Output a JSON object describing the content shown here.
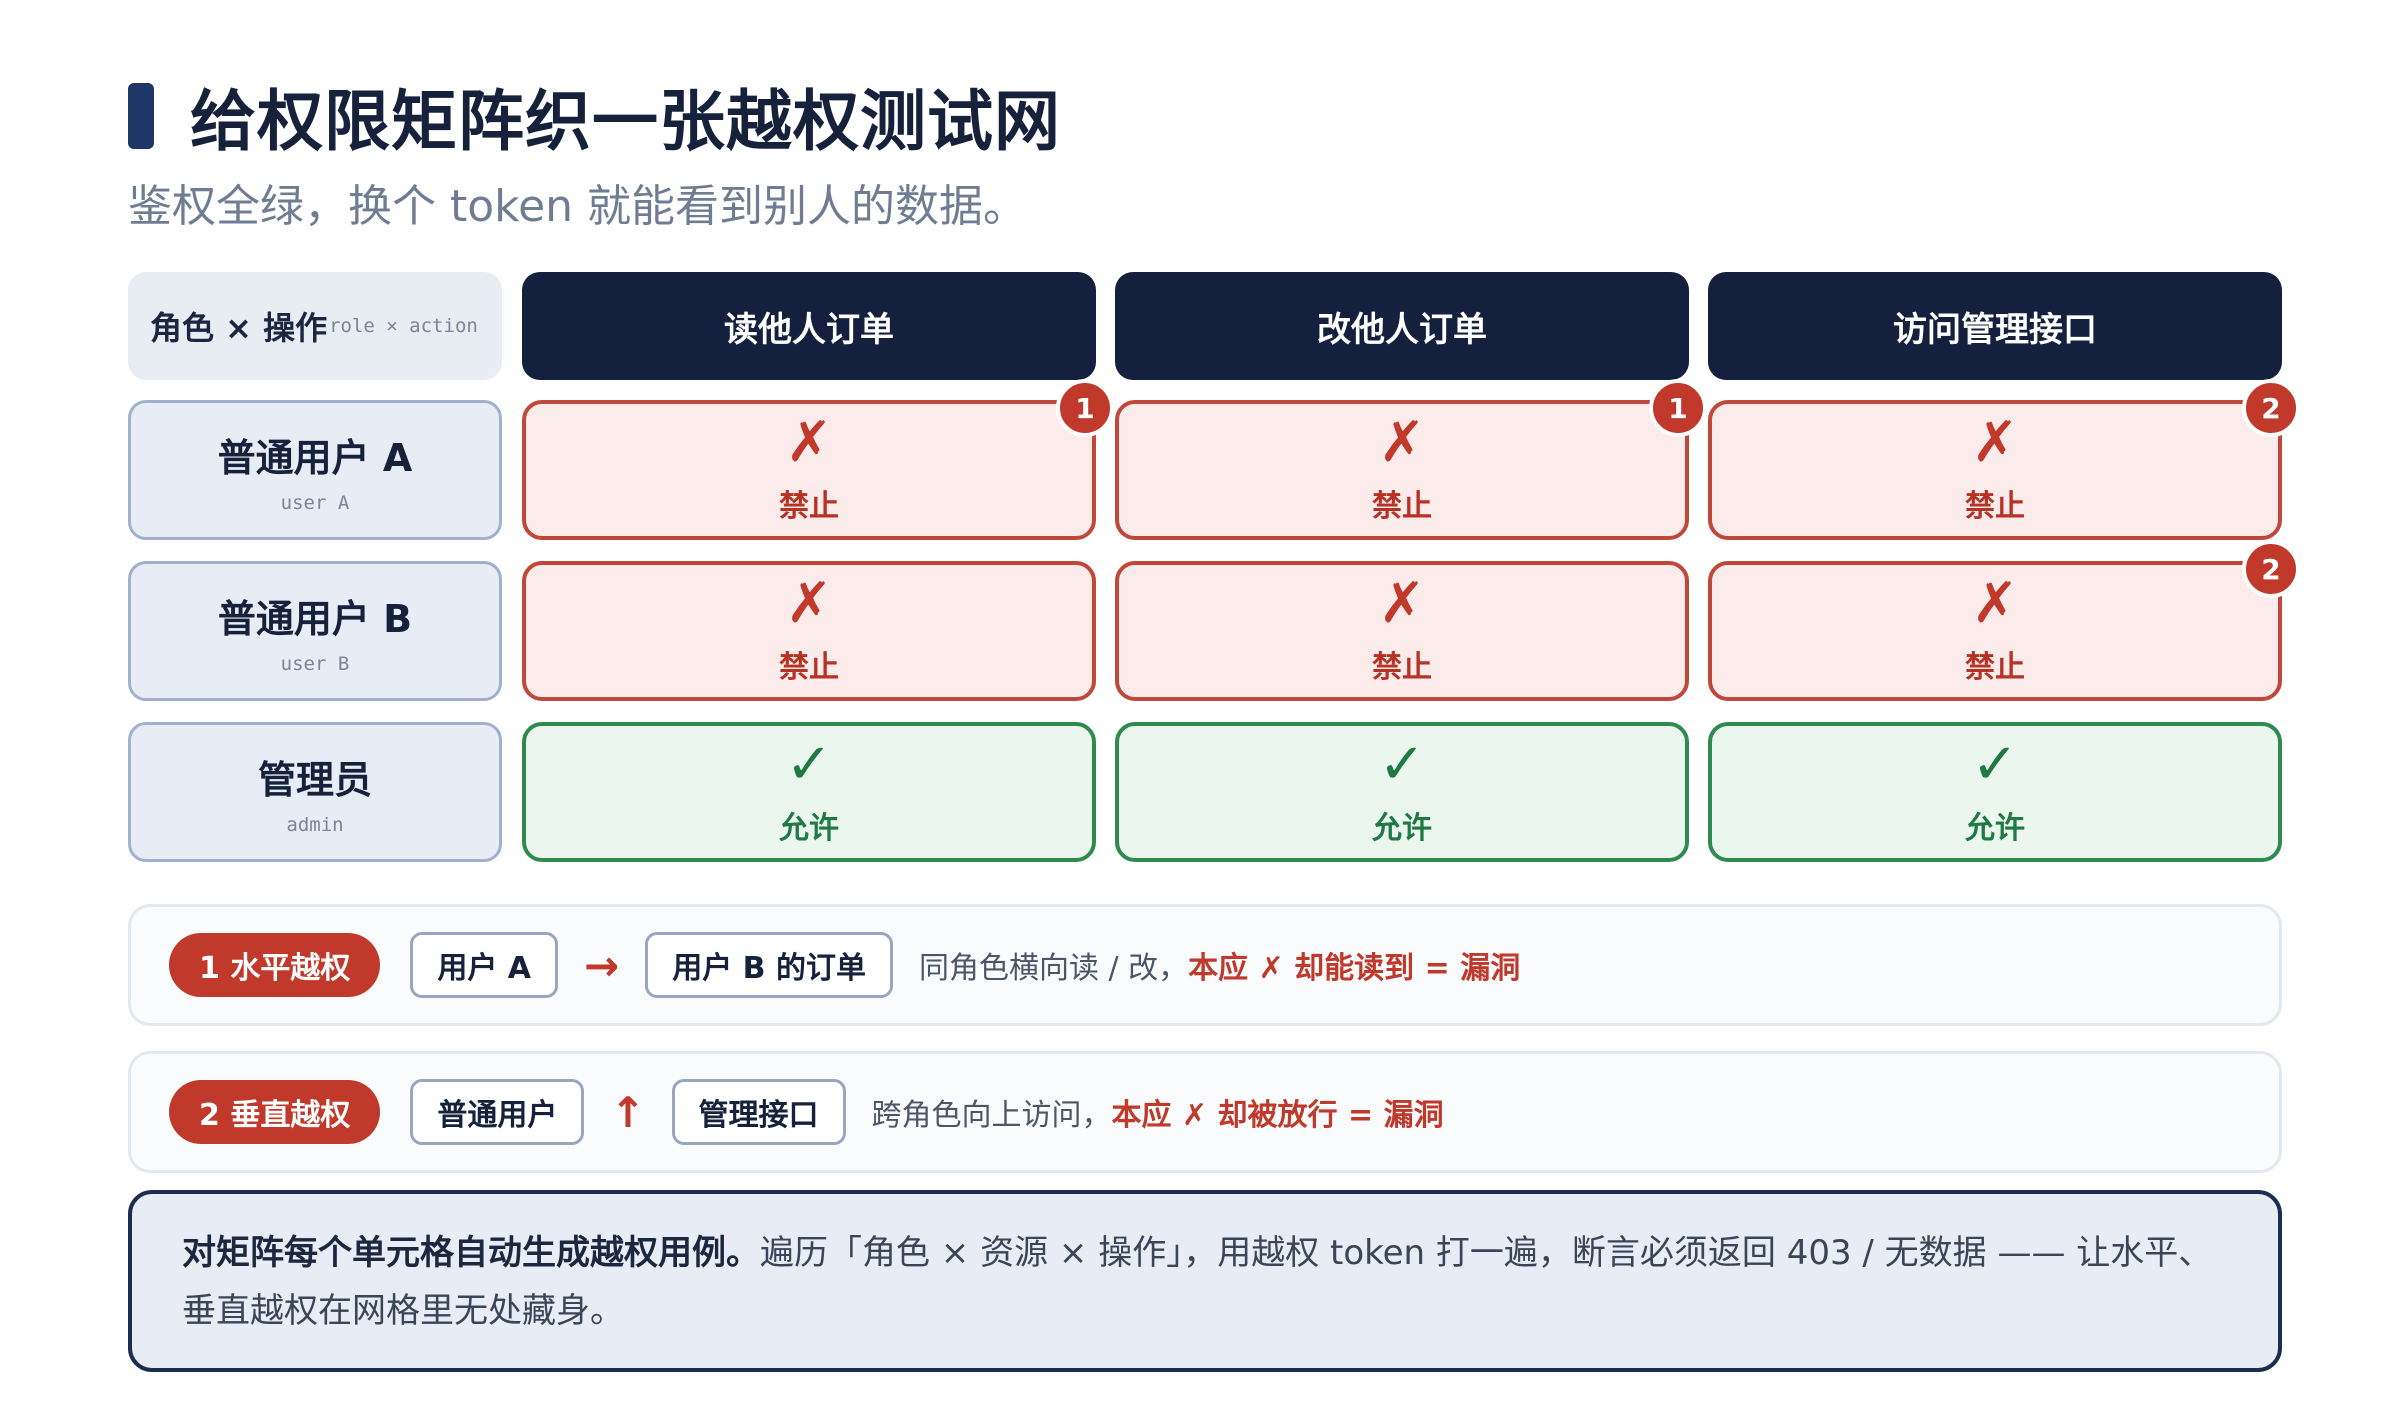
{
  "title": "给权限矩阵织一张越权测试网",
  "subtitle": "鉴权全绿，换个 token 就能看到别人的数据。",
  "matrix": {
    "corner": {
      "zh": "角色 × 操作",
      "en": "role × action"
    },
    "columns": [
      "读他人订单",
      "改他人订单",
      "访问管理接口"
    ],
    "rows": [
      {
        "zh": "普通用户 A",
        "en": "user A",
        "cells": [
          {
            "mark": "✗",
            "verdict": "禁止",
            "badge": "1"
          },
          {
            "mark": "✗",
            "verdict": "禁止",
            "badge": "1"
          },
          {
            "mark": "✗",
            "verdict": "禁止",
            "badge": "2"
          }
        ]
      },
      {
        "zh": "普通用户 B",
        "en": "user B",
        "cells": [
          {
            "mark": "✗",
            "verdict": "禁止",
            "badge": ""
          },
          {
            "mark": "✗",
            "verdict": "禁止",
            "badge": ""
          },
          {
            "mark": "✗",
            "verdict": "禁止",
            "badge": "2"
          }
        ]
      },
      {
        "zh": "管理员",
        "en": "admin",
        "cells": [
          {
            "mark": "✓",
            "verdict": "允许",
            "badge": ""
          },
          {
            "mark": "✓",
            "verdict": "允许",
            "badge": ""
          },
          {
            "mark": "✓",
            "verdict": "允许",
            "badge": ""
          }
        ]
      }
    ]
  },
  "legend": [
    {
      "pill": "1 水平越权",
      "from": "用户 A",
      "arrow": "→",
      "to": "用户 B 的订单",
      "desc": "同角色横向读 / 改，",
      "emphasis": "本应 ✗ 却能读到 = 漏洞"
    },
    {
      "pill": "2 垂直越权",
      "from": "普通用户",
      "arrow": "↑",
      "to": "管理接口",
      "desc": "跨角色向上访问，",
      "emphasis": "本应 ✗ 却被放行 = 漏洞"
    }
  ],
  "note": {
    "bold": "对矩阵每个单元格自动生成越权用例。",
    "text": "遍历「角色 × 资源 × 操作」，用越权 token 打一遍，断言必须返回 403 / 无数据 —— 让水平、垂直越权在网格里无处藏身。"
  },
  "colors": {
    "deny": "#c0392b",
    "allow": "#1e7a42",
    "header": "#14203d",
    "accent": "#1e3766"
  }
}
